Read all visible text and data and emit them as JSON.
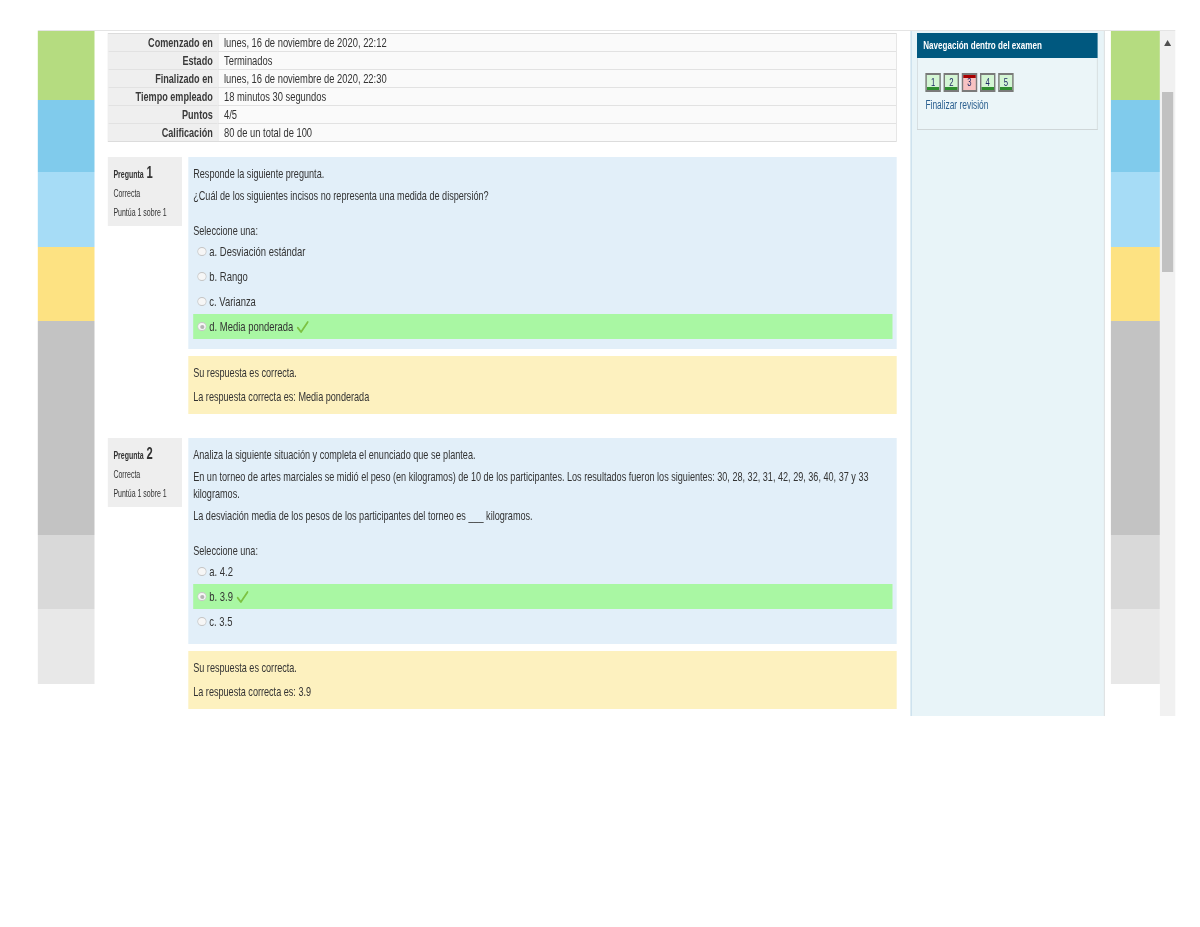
{
  "summary": [
    {
      "label": "Comenzado en",
      "value": "lunes, 16 de noviembre de 2020, 22:12"
    },
    {
      "label": "Estado",
      "value": "Terminados"
    },
    {
      "label": "Finalizado en",
      "value": "lunes, 16 de noviembre de 2020, 22:30"
    },
    {
      "label": "Tiempo empleado",
      "value": "18 minutos 30 segundos"
    },
    {
      "label": "Puntos",
      "value": "4/5"
    },
    {
      "label": "Calificación",
      "value": "80 de un total de 100"
    }
  ],
  "questions": [
    {
      "heading": "Pregunta",
      "number": "1",
      "status": "Correcta",
      "score": "Puntúa 1 sobre 1",
      "paragraphs": [
        "Responde la siguiente pregunta.",
        "¿Cuál de los siguientes incisos no representa una medida de dispersión?"
      ],
      "prompt": "Seleccione una:",
      "options": [
        {
          "label": "a. Desviación estándar",
          "selected": false,
          "correct": false
        },
        {
          "label": "b. Rango",
          "selected": false,
          "correct": false
        },
        {
          "label": "c. Varianza",
          "selected": false,
          "correct": false
        },
        {
          "label": "d. Media ponderada",
          "selected": true,
          "correct": true
        }
      ],
      "feedback": [
        "Su respuesta es correcta.",
        "La respuesta correcta es: Media ponderada"
      ]
    },
    {
      "heading": "Pregunta",
      "number": "2",
      "status": "Correcta",
      "score": "Puntúa 1 sobre 1",
      "paragraphs": [
        "Analiza la siguiente situación y completa el enunciado que se plantea.",
        "En un torneo de artes marciales se midió el peso (en kilogramos) de 10 de los participantes. Los resultados fueron los siguientes: 30, 28, 32, 31, 42, 29, 36, 40, 37 y 33 kilogramos.",
        "La desviación media de los pesos de los participantes del torneo es ___ kilogramos."
      ],
      "prompt": "Seleccione una:",
      "options": [
        {
          "label": "a. 4.2",
          "selected": false,
          "correct": false
        },
        {
          "label": "b. 3.9",
          "selected": true,
          "correct": true
        },
        {
          "label": "c. 3.5",
          "selected": false,
          "correct": false
        }
      ],
      "feedback": [
        "Su respuesta es correcta.",
        "La respuesta correcta es: 3.9"
      ]
    }
  ],
  "navigation": {
    "title": "Navegación dentro del examen",
    "questions": [
      {
        "label": "1",
        "correct": true
      },
      {
        "label": "2",
        "correct": true
      },
      {
        "label": "3",
        "correct": false
      },
      {
        "label": "4",
        "correct": true
      },
      {
        "label": "5",
        "correct": true
      }
    ],
    "finish_link": "Finalizar revisión"
  }
}
